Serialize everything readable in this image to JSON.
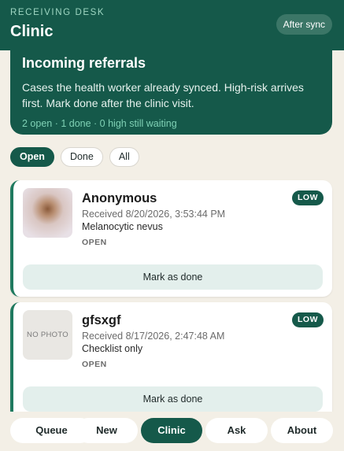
{
  "header": {
    "eyebrow": "RECEIVING DESK",
    "title": "Clinic",
    "sync_label": "After sync"
  },
  "hero": {
    "title": "Incoming referrals",
    "description": "Cases the health worker already synced. High-risk arrives first. Mark done after the clinic visit.",
    "stats": "2 open · 1 done · 0 high still waiting"
  },
  "filters": [
    {
      "label": "Open",
      "active": true
    },
    {
      "label": "Done",
      "active": false
    },
    {
      "label": "All",
      "active": false
    }
  ],
  "cards": [
    {
      "name": "Anonymous",
      "received": "Received 8/20/2026, 3:53:44 PM",
      "detail": "Melanocytic nevus",
      "status": "OPEN",
      "risk": "LOW",
      "photo": true,
      "action_label": "Mark as done"
    },
    {
      "name": "gfsxgf",
      "received": "Received 8/17/2026, 2:47:48 AM",
      "detail": "Checklist only",
      "status": "OPEN",
      "risk": "LOW",
      "photo": false,
      "no_photo_label": "NO PHOTO",
      "action_label": "Mark as done"
    }
  ],
  "nav": [
    {
      "label": "Queue",
      "active": false
    },
    {
      "label": "New",
      "active": false
    },
    {
      "label": "Clinic",
      "active": true
    },
    {
      "label": "Ask",
      "active": false
    },
    {
      "label": "About",
      "active": false
    }
  ],
  "colors": {
    "brand": "#15594a",
    "accent": "#7fd1b5",
    "background": "#f3efe6"
  }
}
